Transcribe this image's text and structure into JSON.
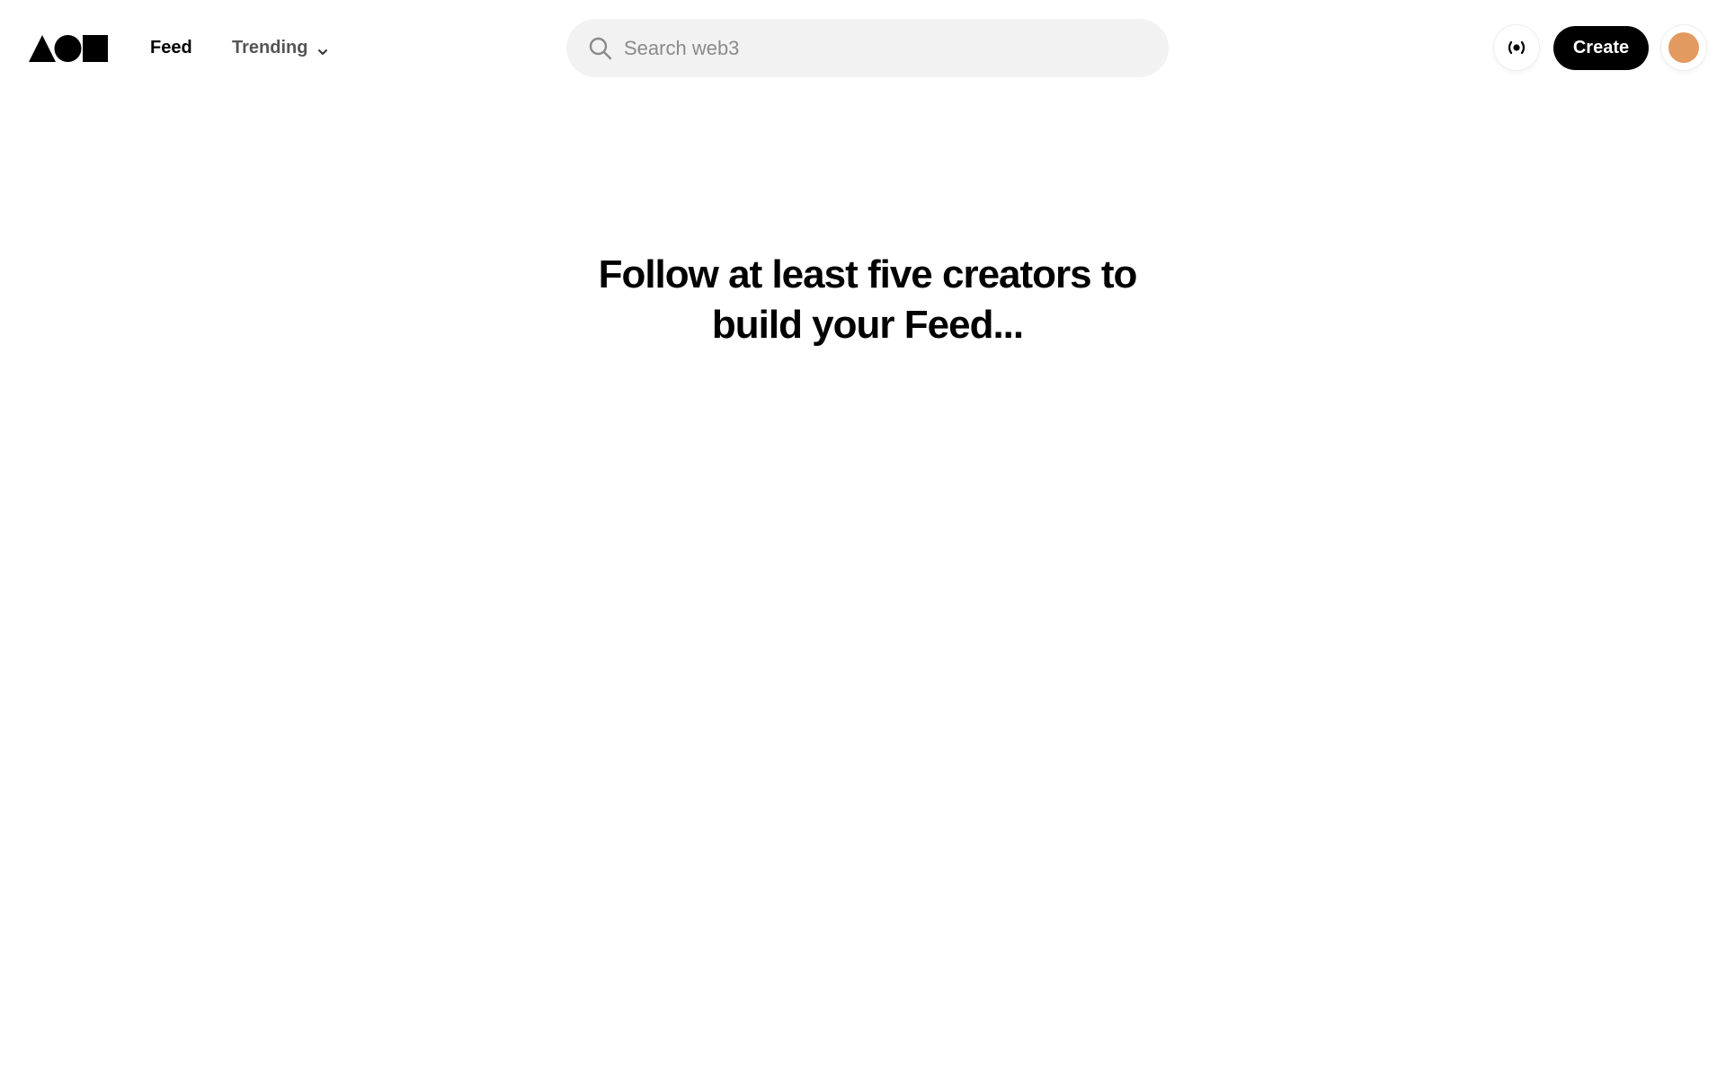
{
  "header": {
    "nav": {
      "feed_label": "Feed",
      "trending_label": "Trending"
    },
    "search": {
      "placeholder": "Search web3",
      "value": ""
    },
    "create_label": "Create"
  },
  "main": {
    "empty_message": "Follow at least five creators to build your Feed..."
  },
  "icons": {
    "logo": "triangle-circle-square-logo",
    "search": "search-icon",
    "trending_dropdown": "chevron-down-icon",
    "live": "broadcast-icon"
  },
  "colors": {
    "primary": "#000000",
    "search_background": "#f2f2f2",
    "avatar": "#e29a61",
    "muted_text": "#555555"
  }
}
